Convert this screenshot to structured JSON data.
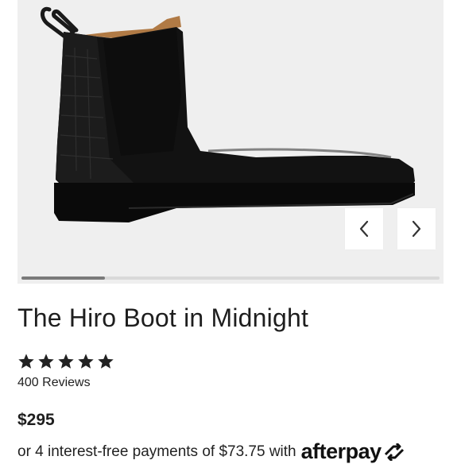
{
  "product": {
    "title": "The Hiro Boot in Midnight",
    "rating": 5,
    "reviews_label": "400 Reviews",
    "price": "$295"
  },
  "payment": {
    "installment_text": "or 4 interest-free payments of $73.75 with",
    "provider": "afterpay"
  },
  "gallery": {
    "image_alt": "Black leather Chelsea boot with croc-embossed heel",
    "prev_icon": "chevron-left-icon",
    "next_icon": "chevron-right-icon",
    "scroll_progress": 0.2
  }
}
